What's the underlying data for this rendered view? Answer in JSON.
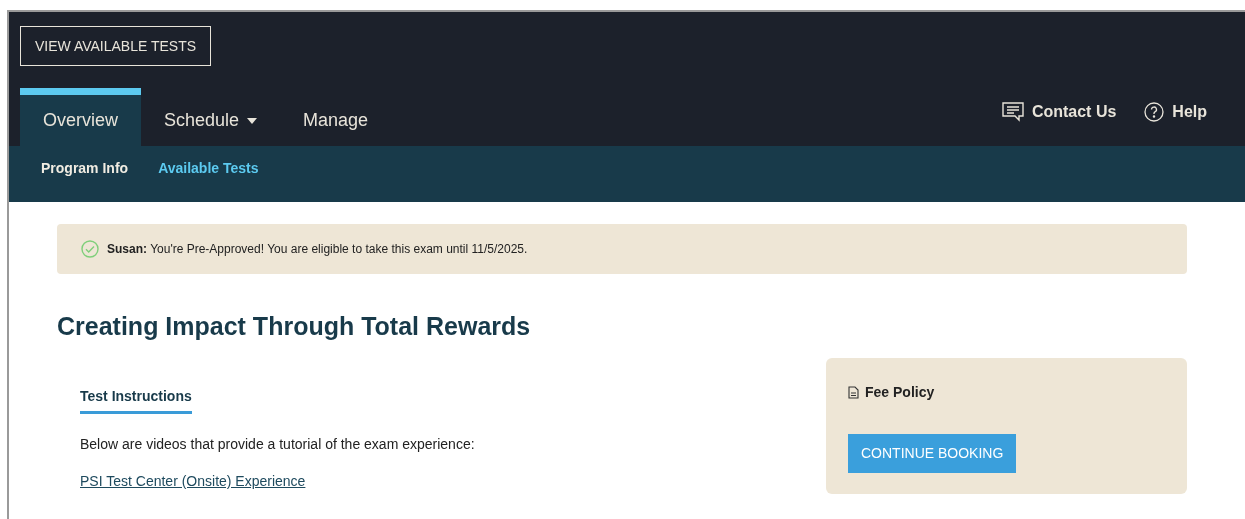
{
  "header": {
    "button": "VIEW AVAILABLE TESTS",
    "tabs": [
      {
        "label": "Overview",
        "selected": true,
        "dropdown": false
      },
      {
        "label": "Schedule",
        "selected": false,
        "dropdown": true
      },
      {
        "label": "Manage",
        "selected": false,
        "dropdown": false
      }
    ],
    "links": [
      {
        "label": "Contact Us",
        "kind": "chat"
      },
      {
        "label": "Help",
        "kind": "help"
      }
    ]
  },
  "subnav": [
    {
      "label": "Program Info",
      "selected": false
    },
    {
      "label": "Available Tests",
      "selected": true
    }
  ],
  "alert": {
    "text": "**Susan:** You're Pre-Approved! You are eligible to take this exam until 11/5/2025."
  },
  "title": "Creating Impact Through Total Rewards",
  "instructions": {
    "tab": "Test Instructions",
    "text": "Below are videos that provide a tutorial of the exam experience:",
    "link": "PSI Test Center (Onsite) Experience"
  },
  "side_card": {
    "fee_policy": "Fee Policy",
    "button": "CONTINUE BOOKING"
  }
}
